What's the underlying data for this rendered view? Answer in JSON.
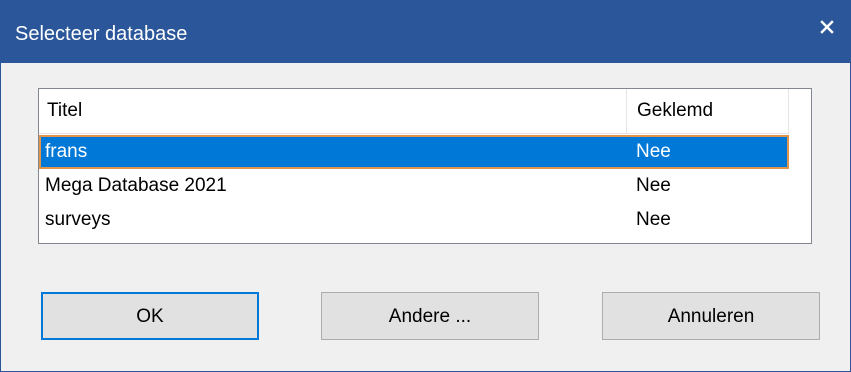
{
  "window": {
    "title": "Selecteer database",
    "close_symbol": "×"
  },
  "colors": {
    "titlebar": "#2b579a",
    "selection": "#0078d7",
    "focus_border": "#e2944a",
    "default_button_border": "#0078d7"
  },
  "list": {
    "columns": {
      "title": "Titel",
      "pinned": "Geklemd"
    },
    "rows": [
      {
        "title": "frans",
        "pinned": "Nee",
        "selected": true
      },
      {
        "title": "Mega Database 2021",
        "pinned": "Nee",
        "selected": false
      },
      {
        "title": "surveys",
        "pinned": "Nee",
        "selected": false
      }
    ]
  },
  "buttons": {
    "ok_label": "OK",
    "other_label": "Andere ...",
    "cancel_label": "Annuleren"
  },
  "icons": {
    "close": "close-icon"
  }
}
